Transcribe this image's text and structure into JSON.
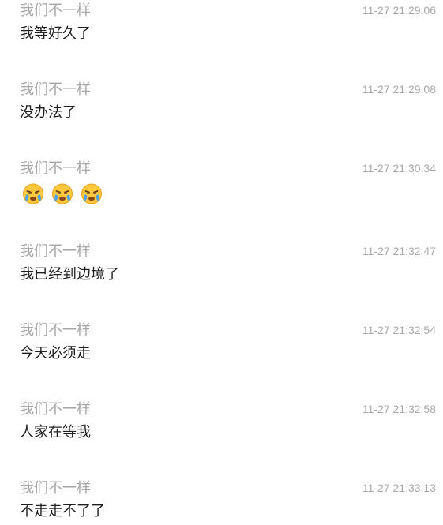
{
  "messages": [
    {
      "sender": "我们不一样",
      "time": "11-27 21:29:06",
      "text": "我等好久了"
    },
    {
      "sender": "我们不一样",
      "time": "11-27 21:29:08",
      "text": "没办法了"
    },
    {
      "sender": "我们不一样",
      "time": "11-27 21:30:34",
      "emojis": [
        "crying-face-icon",
        "crying-face-icon",
        "crying-face-icon"
      ]
    },
    {
      "sender": "我们不一样",
      "time": "11-27 21:32:47",
      "text": "我已经到边境了"
    },
    {
      "sender": "我们不一样",
      "time": "11-27 21:32:54",
      "text": "今天必须走"
    },
    {
      "sender": "我们不一样",
      "time": "11-27 21:32:58",
      "text": "人家在等我"
    },
    {
      "sender": "我们不一样",
      "time": "11-27 21:33:13",
      "text": "不走走不了了"
    }
  ],
  "colors": {
    "sender": "#a6a6a6",
    "time": "#a9a9a9",
    "text": "#1f1f1f",
    "emoji_face": "#ffc83d",
    "emoji_tears": "#4aa3e8"
  }
}
